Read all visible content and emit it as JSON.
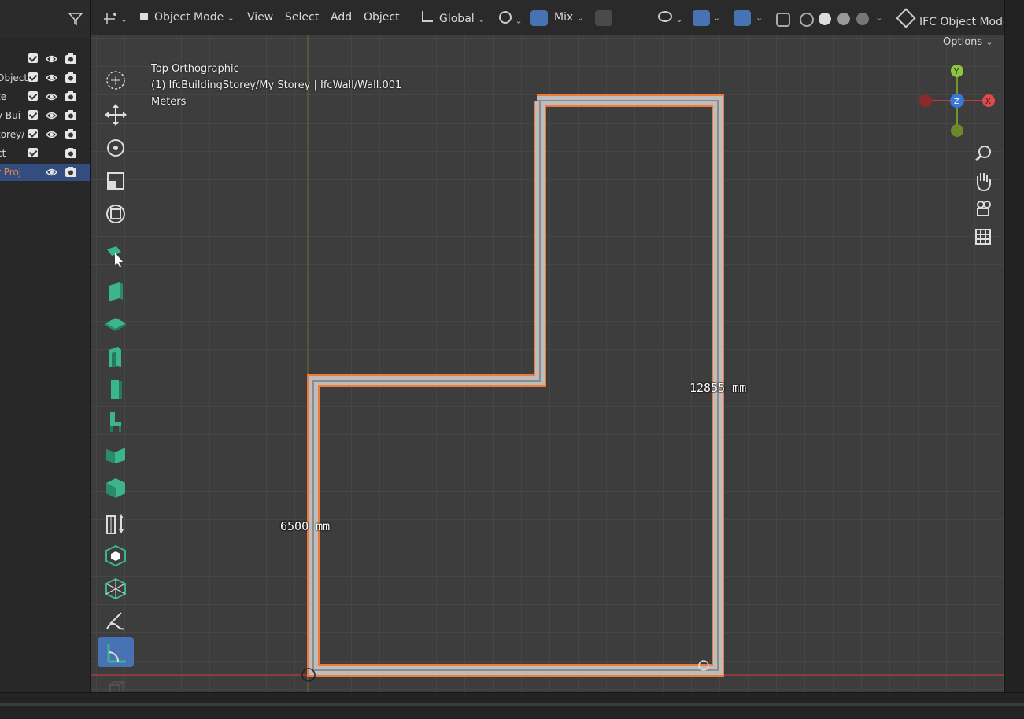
{
  "outliner": {
    "rows": [
      {
        "label": "",
        "active": false,
        "checkbox": true,
        "eye": true,
        "camera": true
      },
      {
        "label": "Object",
        "active": false,
        "checkbox": true,
        "eye": true,
        "camera": true
      },
      {
        "label": "te",
        "active": false,
        "checkbox": true,
        "eye": true,
        "camera": true
      },
      {
        "label": "y Bui",
        "active": false,
        "checkbox": true,
        "eye": true,
        "camera": true
      },
      {
        "label": "torey/",
        "active": false,
        "checkbox": true,
        "eye": true,
        "camera": true
      },
      {
        "label": "ct",
        "active": false,
        "checkbox": true,
        "eye": false,
        "camera": true
      },
      {
        "label": "r Proj",
        "active": true,
        "checkbox": false,
        "eye": true,
        "camera": true
      }
    ]
  },
  "header": {
    "mode_label": "Object Mode",
    "menus": [
      "View",
      "Select",
      "Add",
      "Object"
    ],
    "orientation_label": "Global",
    "snap_label": "Mix",
    "ifc_mode_label": "IFC Object Mode",
    "options_label": "Options"
  },
  "viewport": {
    "view_name": "Top Orthographic",
    "context": "(1) IfcBuildingStorey/My Storey | IfcWall/Wall.001",
    "units": "Meters",
    "dimension_right": "12855 mm",
    "dimension_left": "6500 mm",
    "wall_color": "#bdbdbd",
    "selection_color": "#f07a3a"
  },
  "gizmo": {
    "x_label": "X",
    "y_label": "Y",
    "z_label": "Z"
  },
  "colors": {
    "accent": "#4772b3",
    "tool_teal": "#3cb58f"
  }
}
